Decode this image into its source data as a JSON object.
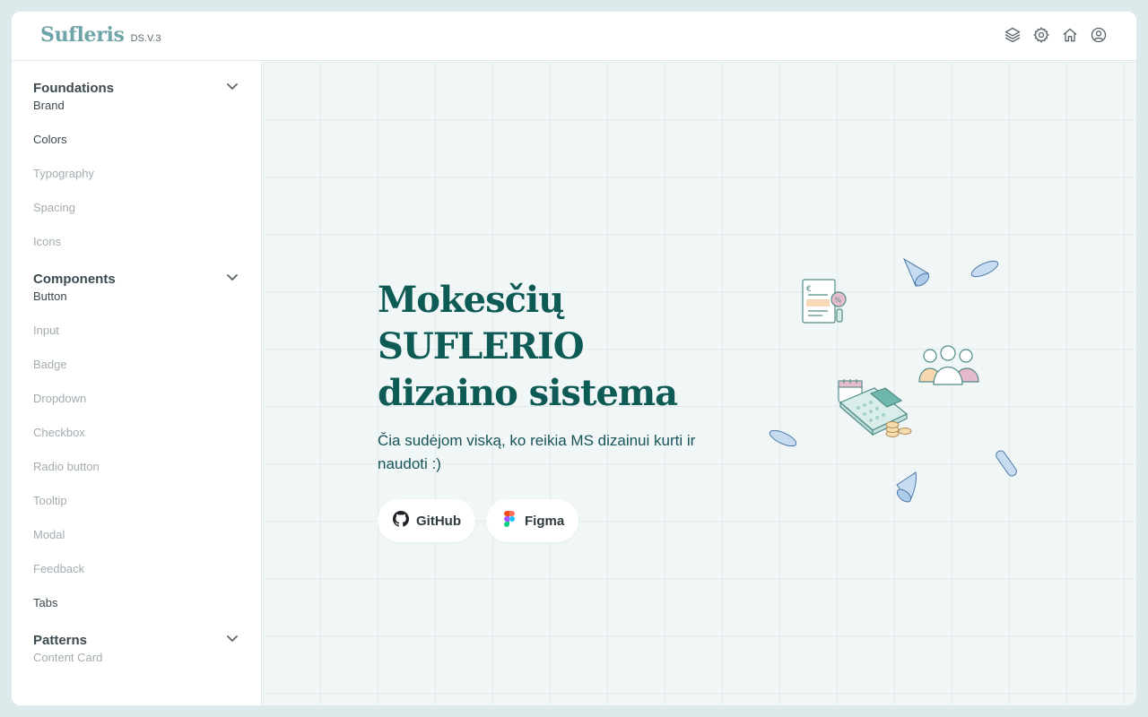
{
  "header": {
    "brand_name": "Sufleris",
    "version": "DS.V.3",
    "icons": [
      "layers-icon",
      "gear-icon",
      "home-icon",
      "user-circle-icon"
    ]
  },
  "sidebar": {
    "sections": [
      {
        "title": "Foundations",
        "items": [
          {
            "label": "Brand",
            "state": "active"
          },
          {
            "label": "Colors",
            "state": "active"
          },
          {
            "label": "Typography",
            "state": "muted"
          },
          {
            "label": "Spacing",
            "state": "muted"
          },
          {
            "label": "Icons",
            "state": "muted"
          }
        ]
      },
      {
        "title": "Components",
        "items": [
          {
            "label": "Button",
            "state": "active"
          },
          {
            "label": "Input",
            "state": "muted"
          },
          {
            "label": "Badge",
            "state": "muted"
          },
          {
            "label": "Dropdown",
            "state": "muted"
          },
          {
            "label": "Checkbox",
            "state": "muted"
          },
          {
            "label": "Radio button",
            "state": "muted"
          },
          {
            "label": "Tooltip",
            "state": "muted"
          },
          {
            "label": "Modal",
            "state": "muted"
          },
          {
            "label": "Feedback",
            "state": "muted"
          },
          {
            "label": "Tabs",
            "state": "active"
          }
        ]
      },
      {
        "title": "Patterns",
        "items": [
          {
            "label": "Content Card",
            "state": "muted"
          }
        ]
      }
    ]
  },
  "hero": {
    "title_line1": "Mokesčių SUFLERIO",
    "title_line2": "dizaino sistema",
    "subtitle_line1": "Čia sudėjom viską, ko reikia MS dizainui kurti ir",
    "subtitle_line2": "naudoti :)",
    "buttons": {
      "github_label": "GitHub",
      "figma_label": "Figma"
    }
  },
  "colors": {
    "brand": "#6fa4a8",
    "heading": "#0e5a55",
    "background": "#f1f6f6",
    "page_bg": "#dde9ea"
  }
}
